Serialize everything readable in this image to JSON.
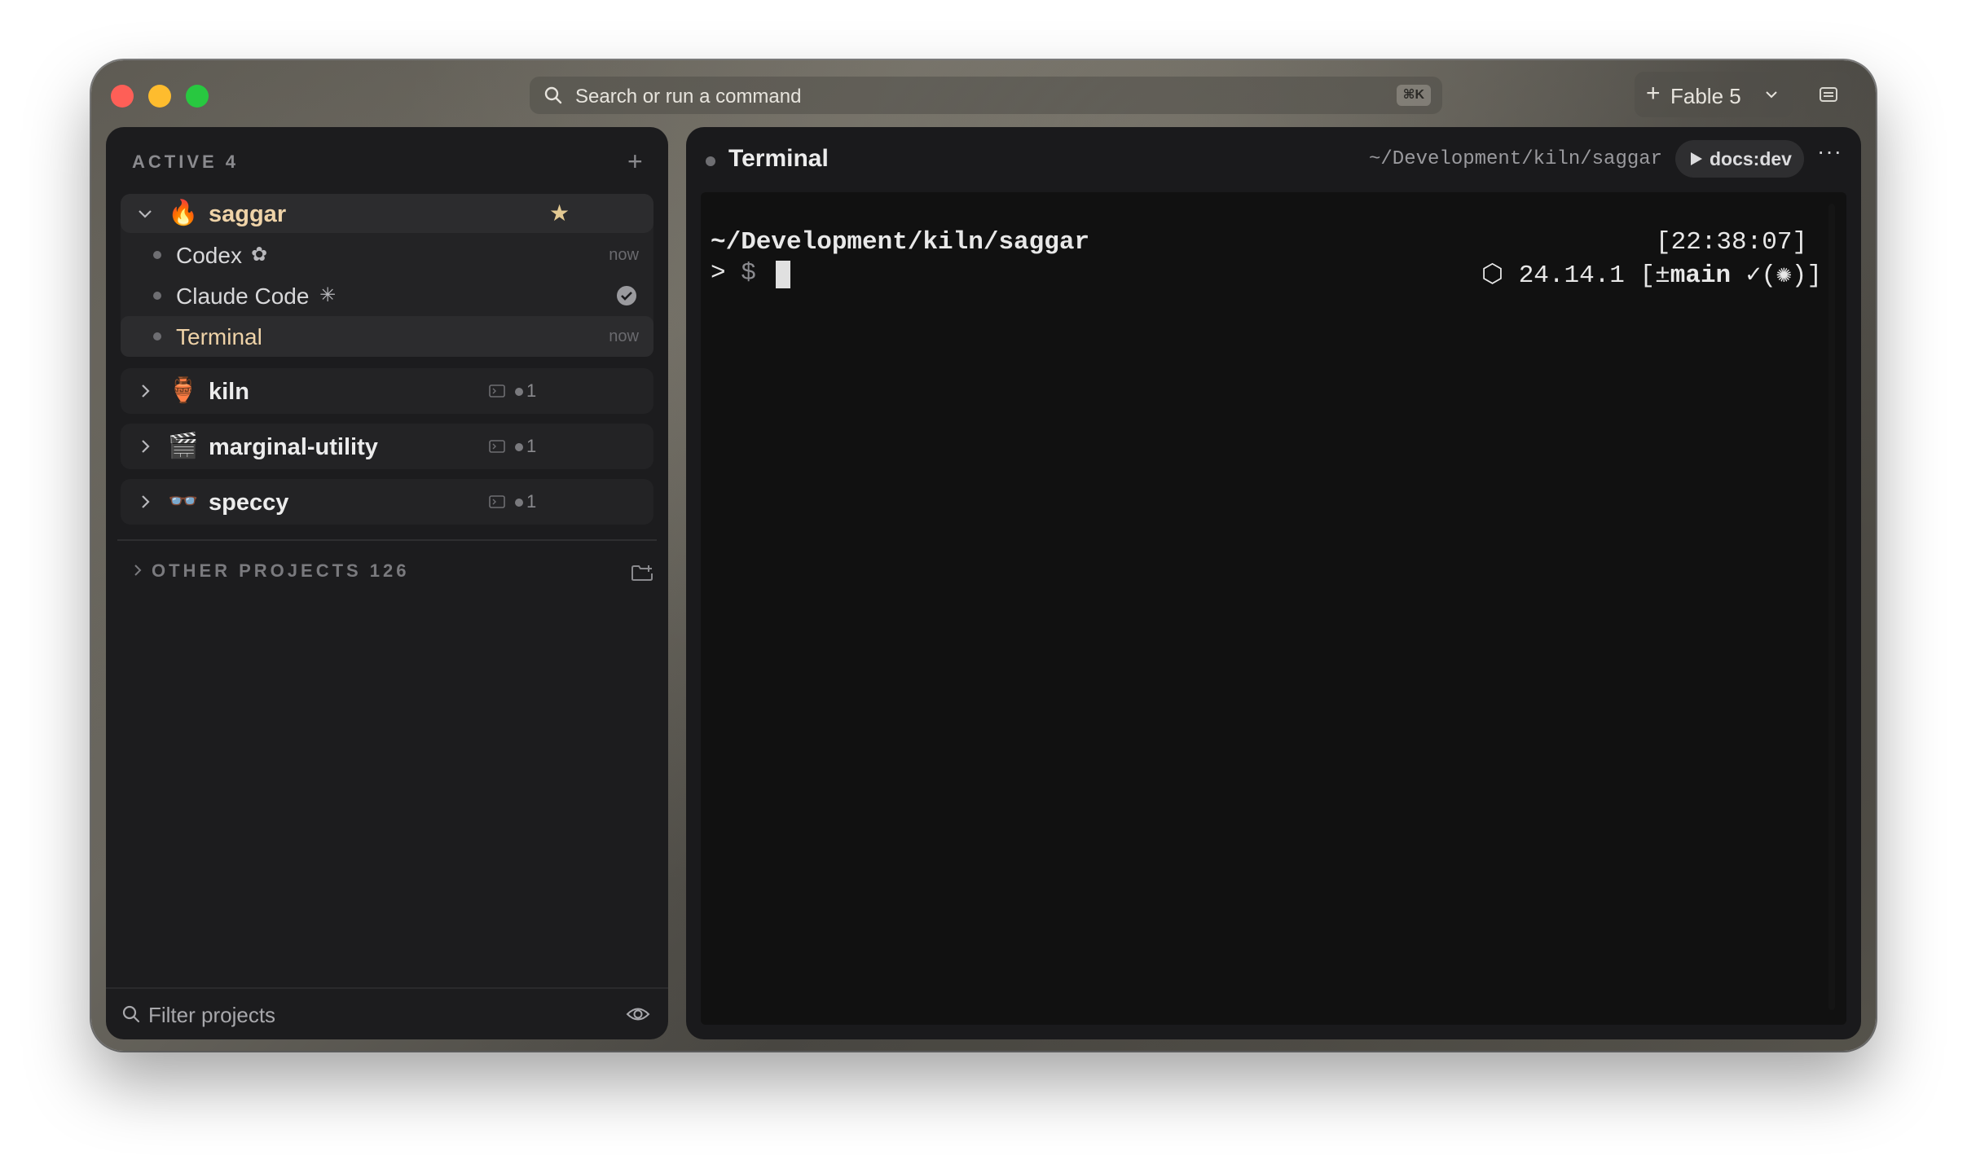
{
  "toolbar": {
    "search_placeholder": "Search or run a command",
    "search_shortcut": "⌘K",
    "workspace_plus": "+",
    "workspace_label": "Fable 5"
  },
  "sidebar": {
    "active_header": "ACTIVE 4",
    "add_label": "+",
    "projects": [
      {
        "name": "saggar",
        "emoji": "🔥",
        "starred": true,
        "sessions": [
          {
            "name": "Codex",
            "icon": "✿",
            "time": "now"
          },
          {
            "name": "Claude Code",
            "icon": "✳",
            "time": ""
          },
          {
            "name": "Terminal",
            "icon": "",
            "time": "now"
          }
        ]
      },
      {
        "name": "kiln",
        "emoji": "🏺",
        "count": "1"
      },
      {
        "name": "marginal-utility",
        "emoji": "🎬",
        "count": "1"
      },
      {
        "name": "speccy",
        "emoji": "👓",
        "count": "1"
      }
    ],
    "other_header": "OTHER PROJECTS 126",
    "filter_placeholder": "Filter projects"
  },
  "panel": {
    "title": "Terminal",
    "path": "~/Development/kiln/saggar",
    "run_label": "docs:dev",
    "more_label": "···"
  },
  "terminal": {
    "cwd": "~/Development/kiln/saggar",
    "clock": "[22:38:07]",
    "prompt_caret": ">",
    "prompt_dollar": "$",
    "node_icon": "⬡",
    "node_version": "24.14.1",
    "git_open": "[±",
    "git_branch": "main",
    "git_status": "✓(✺)]"
  },
  "colors": {
    "accent_project": "#efd3a8",
    "star": "#e3c992",
    "close": "#fe5f57",
    "minimize": "#febc2e",
    "maximize": "#28c840"
  }
}
